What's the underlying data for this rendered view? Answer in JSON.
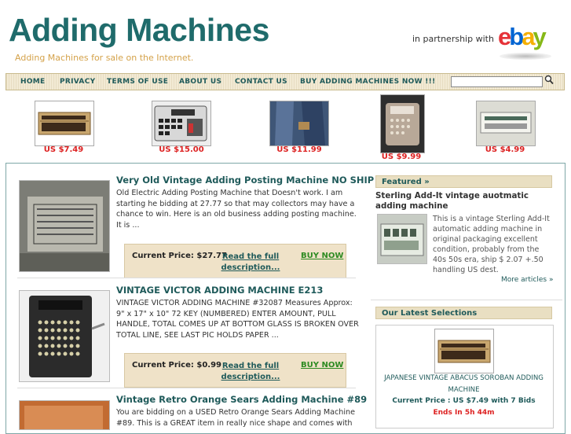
{
  "header": {
    "title": "Adding Machines",
    "tagline": "Adding Machines for sale on the Internet.",
    "partner_text": "in partnership with",
    "ebay_logo": {
      "e": "e",
      "b": "b",
      "a": "a",
      "y": "y"
    }
  },
  "nav": {
    "items": [
      "HOME",
      "PRIVACY",
      "TERMS OF USE",
      "ABOUT US",
      "CONTACT US",
      "BUY ADDING MACHINES NOW !!!"
    ],
    "search_placeholder": ""
  },
  "carousel": [
    {
      "price": "US $7.49",
      "icon": "abacus-image"
    },
    {
      "price": "US $15.00",
      "icon": "calculator-image"
    },
    {
      "price": "US $11.99",
      "icon": "jeans-image"
    },
    {
      "price": "US $9.99",
      "icon": "cash-register-image"
    },
    {
      "price": "US $4.99",
      "icon": "sign-image"
    }
  ],
  "listings": [
    {
      "title": "Very Old Vintage Adding Posting Machine NO SHIP",
      "description": "Old Electric Adding Posting Machine that Doesn't work. I am starting he bidding at 27.77 so that may collectors may have a chance to win. Here is an old business adding posting machine. It is ...",
      "price_label": "Current Price: $27.77",
      "read_more": "Read the full description...",
      "buy": "BUY NOW"
    },
    {
      "title": "VINTAGE VICTOR ADDING MACHINE E213",
      "description": "VINTAGE VICTOR ADDING MACHINE #32087 Measures Approx: 9\" x 17\" x 10\" 72 KEY (NUMBERED) ENTER AMOUNT, PULL HANDLE, TOTAL COMES UP AT BOTTOM GLASS IS BROKEN OVER TOTAL LINE, SEE LAST PIC HOLDS PAPER ...",
      "price_label": "Current Price: $0.99",
      "read_more": "Read the full description...",
      "buy": "BUY NOW"
    },
    {
      "title": "Vintage Retro Orange Sears Adding Machine #89",
      "description": "You are bidding on a USED Retro Orange Sears Adding Machine #89. This is a GREAT item in really nice shape and comes with"
    }
  ],
  "sidebar": {
    "featured_heading": "Featured »",
    "featured_title": "Sterling Add-It vintage auotmatic adding machine",
    "featured_desc": "This is a vintage Sterling Add-It automatic adding machine in original packaging excellent condition, probably from the 40s 50s era, ship $ 2.07 +.50 handling US dest.",
    "more_articles": "More articles »",
    "latest_heading": "Our Latest Selections",
    "latest_title": "JAPANESE VINTAGE ABACUS SOROBAN ADDING MACHINE",
    "latest_price": "Current Price : US $7.49 with 7 Bids",
    "latest_ends": "Ends In 5h 44m"
  },
  "colors": {
    "brand": "#1f6b6b",
    "price_red": "#dd2222",
    "buy_green": "#2e8b22",
    "nav_bg": "#f2ead4"
  }
}
